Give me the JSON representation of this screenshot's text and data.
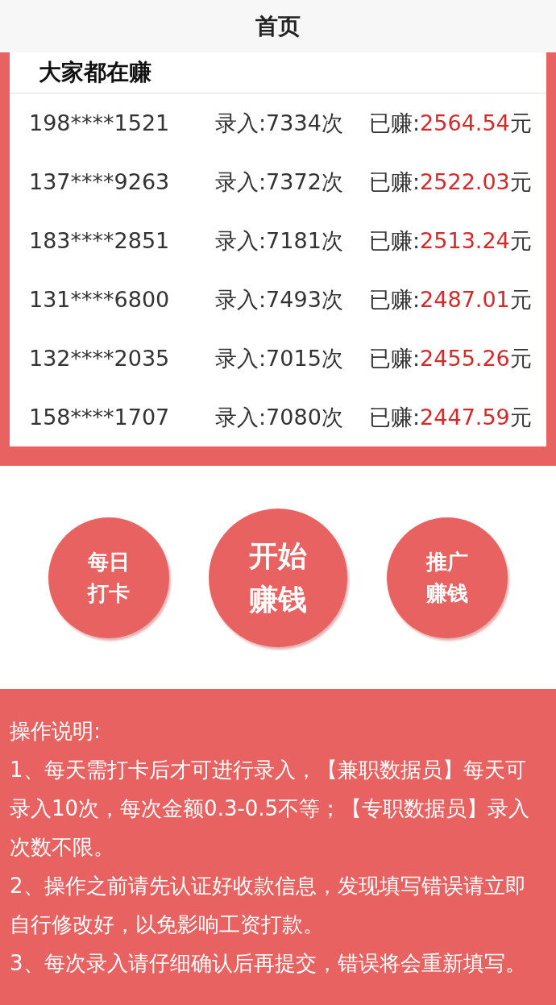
{
  "header": {
    "title": "首页"
  },
  "ranking": {
    "title": "大家都在赚",
    "rows": [
      {
        "phone": "198****1521",
        "entries": "录入:7334次",
        "earned_label": "已赚:",
        "amount": "2564.54",
        "unit": "元"
      },
      {
        "phone": "137****9263",
        "entries": "录入:7372次",
        "earned_label": "已赚:",
        "amount": "2522.03",
        "unit": "元"
      },
      {
        "phone": "183****2851",
        "entries": "录入:7181次",
        "earned_label": "已赚:",
        "amount": "2513.24",
        "unit": "元"
      },
      {
        "phone": "131****6800",
        "entries": "录入:7493次",
        "earned_label": "已赚:",
        "amount": "2487.01",
        "unit": "元"
      },
      {
        "phone": "132****2035",
        "entries": "录入:7015次",
        "earned_label": "已赚:",
        "amount": "2455.26",
        "unit": "元"
      },
      {
        "phone": "158****1707",
        "entries": "录入:7080次",
        "earned_label": "已赚:",
        "amount": "2447.59",
        "unit": "元"
      }
    ]
  },
  "actions": [
    {
      "kind": "small",
      "lines": [
        "每日",
        "打卡"
      ]
    },
    {
      "kind": "large",
      "lines": [
        "开始",
        "赚钱"
      ]
    },
    {
      "kind": "small",
      "lines": [
        "推广",
        "赚钱"
      ]
    }
  ],
  "instructions": {
    "title": "操作说明:",
    "items": [
      "1、每天需打卡后才可进行录入，【兼职数据员】每天可录入10次，每次金额0.3-0.5不等；【专职数据员】录入次数不限。",
      "2、操作之前请先认证好收款信息，发现填写错误请立即自行修改好，以免影响工资打款。",
      "3、每次录入请仔细确认后再提交，错误将会重新填写。"
    ]
  }
}
